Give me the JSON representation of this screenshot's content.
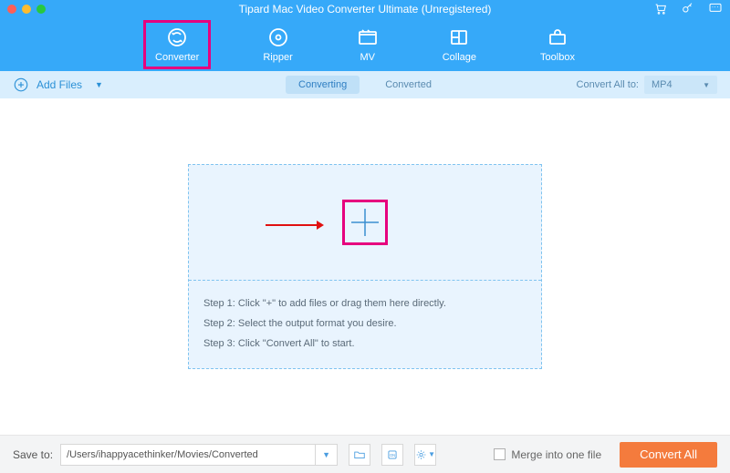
{
  "title": "Tipard Mac Video Converter Ultimate (Unregistered)",
  "nav": {
    "items": [
      {
        "label": "Converter"
      },
      {
        "label": "Ripper"
      },
      {
        "label": "MV"
      },
      {
        "label": "Collage"
      },
      {
        "label": "Toolbox"
      }
    ]
  },
  "subbar": {
    "addFiles": "Add Files",
    "tabs": {
      "converting": "Converting",
      "converted": "Converted"
    },
    "convertAllTo": "Convert All to:",
    "format": "MP4"
  },
  "steps": {
    "s1": "Step 1: Click \"+\" to add files or drag them here directly.",
    "s2": "Step 2: Select the output format you desire.",
    "s3": "Step 3: Click \"Convert All\" to start."
  },
  "footer": {
    "saveTo": "Save to:",
    "path": "/Users/ihappyacethinker/Movies/Converted",
    "merge": "Merge into one file",
    "convertAll": "Convert All"
  }
}
